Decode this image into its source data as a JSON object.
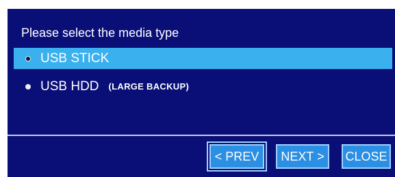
{
  "dialog": {
    "prompt": "Please select the media type",
    "options": [
      {
        "label": "USB STICK",
        "note": "",
        "selected": true
      },
      {
        "label": "USB HDD",
        "note": "(LARGE BACKUP)",
        "selected": false
      }
    ],
    "buttons": {
      "prev_label": "< PREV",
      "next_label": "NEXT >",
      "close_label": "CLOSE"
    }
  },
  "colors": {
    "dialog_background": "#0a0f78",
    "selection_highlight": "#3bb0ee",
    "button_background": "#2b8fe3",
    "button_border": "#9fd2ff",
    "text": "#ffffff"
  }
}
